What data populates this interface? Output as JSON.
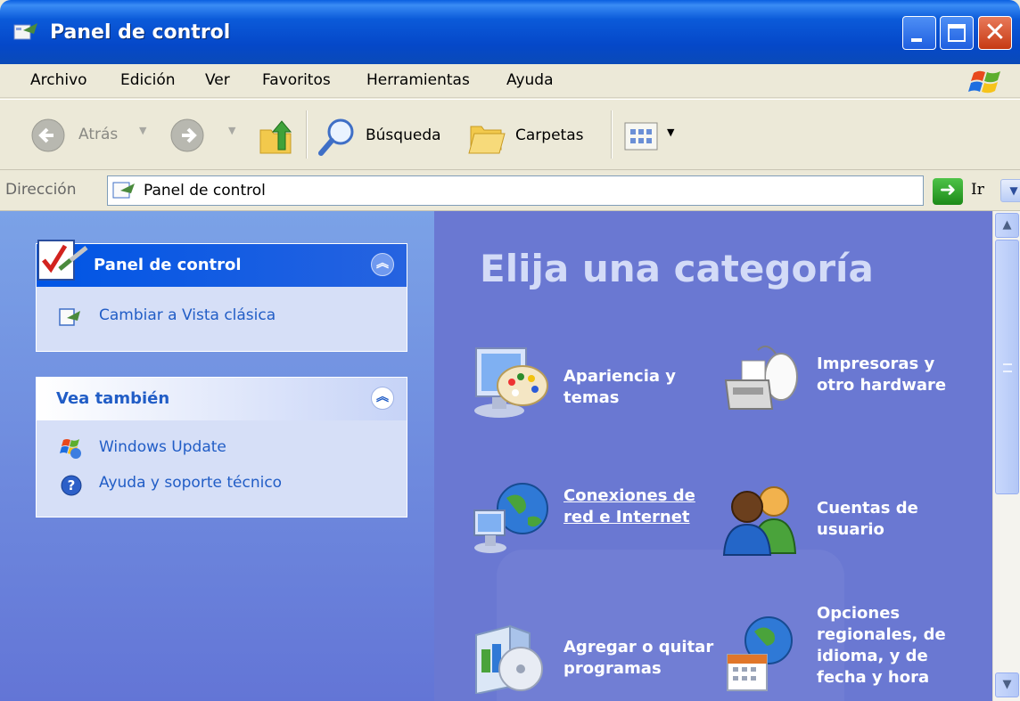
{
  "window": {
    "title": "Panel de control",
    "close_glyph": "✕"
  },
  "menu": {
    "items": [
      "Archivo",
      "Edición",
      "Ver",
      "Favoritos",
      "Herramientas",
      "Ayuda"
    ]
  },
  "toolbar": {
    "back_label": "Atrás",
    "search_label": "Búsqueda",
    "folders_label": "Carpetas"
  },
  "address": {
    "label": "Dirección",
    "value": "Panel de control",
    "go_label": "Ir"
  },
  "sidebar": {
    "panel": {
      "title": "Panel de control",
      "items": [
        {
          "label": "Cambiar a Vista clásica",
          "icon": "switch-view-icon"
        }
      ]
    },
    "see_also": {
      "title": "Vea también",
      "items": [
        {
          "label": "Windows Update",
          "icon": "windows-update-icon"
        },
        {
          "label": "Ayuda y soporte técnico",
          "icon": "help-icon"
        }
      ]
    }
  },
  "main": {
    "heading": "Elija una categoría",
    "categories": [
      {
        "label": "Apariencia y temas",
        "icon": "appearance-icon"
      },
      {
        "label": "Impresoras y otro hardware",
        "icon": "printer-icon"
      },
      {
        "label": "Conexiones de red e Internet",
        "icon": "network-icon"
      },
      {
        "label": "Cuentas de usuario",
        "icon": "users-icon"
      },
      {
        "label": "Agregar o quitar programas",
        "icon": "add-remove-programs-icon"
      },
      {
        "label": "Opciones regionales, de idioma, y de fecha y hora",
        "icon": "regional-options-icon"
      }
    ]
  },
  "colors": {
    "title_bar": "#0548c9",
    "sidebar_bg": "#7ba2e7",
    "main_bg": "#6a78d2",
    "link": "#215dc6"
  }
}
